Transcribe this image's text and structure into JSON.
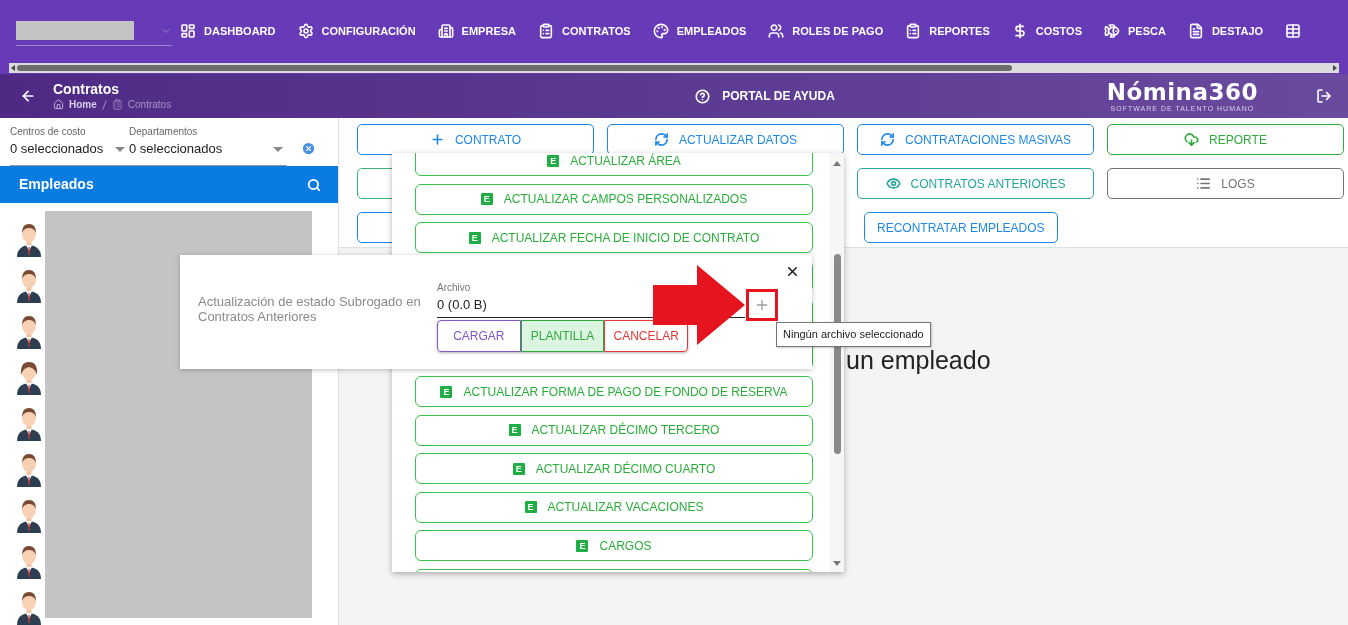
{
  "nav": {
    "items": [
      {
        "label": "DASHBOARD"
      },
      {
        "label": "CONFIGURACIÓN"
      },
      {
        "label": "EMPRESA"
      },
      {
        "label": "CONTRATOS"
      },
      {
        "label": "EMPLEADOS"
      },
      {
        "label": "ROLES DE PAGO"
      },
      {
        "label": "REPORTES"
      },
      {
        "label": "COSTOS"
      },
      {
        "label": "PESCA"
      },
      {
        "label": "DESTAJO"
      }
    ]
  },
  "header": {
    "title": "Contratos",
    "breadcrumb": [
      {
        "label": "Home",
        "selected": false
      },
      {
        "label": "Contratos",
        "selected": true
      }
    ],
    "help": "PORTAL DE AYUDA",
    "logo": {
      "name": "Nómina360",
      "tagline": "SOFTWARE DE TALENTO HUMANO"
    }
  },
  "filters": [
    {
      "label": "Centros de costo",
      "value": "0 seleccionados"
    },
    {
      "label": "Departamentos",
      "value": "0 seleccionados"
    }
  ],
  "employees_panel": {
    "title": "Empleados",
    "employees": [
      {
        "kind": "male"
      },
      {
        "kind": "male"
      },
      {
        "kind": "male"
      },
      {
        "kind": "female"
      },
      {
        "kind": "male"
      },
      {
        "kind": "male"
      },
      {
        "kind": "male"
      },
      {
        "kind": "male"
      },
      {
        "kind": "male"
      }
    ]
  },
  "actions": [
    [
      {
        "kind": "full",
        "label": "CONTRATO",
        "color": "#1e88e5"
      },
      {
        "kind": "full",
        "label": "ACTUALIZAR DATOS",
        "color": "#1e88e5"
      },
      {
        "kind": "full",
        "label": "CONTRATACIONES MASIVAS",
        "color": "#1e88e5"
      },
      {
        "kind": "full",
        "label": "REPORTE",
        "color": "#2eaa3c"
      }
    ],
    [
      {
        "kind": "covered",
        "color": "#3bb17a"
      },
      {
        "kind": "hidden"
      },
      {
        "kind": "full",
        "label": "CONTRATOS ANTERIORES",
        "color": "#26a69a"
      },
      {
        "kind": "full",
        "label": "LOGS",
        "color": "#757575"
      }
    ],
    [
      {
        "kind": "covered",
        "color": "#1e88e5"
      },
      {
        "kind": "hidden"
      },
      {
        "kind": "compact",
        "label": "RECONTRATAR EMPLEADOS",
        "color": "#1e88e5"
      }
    ]
  ],
  "menu": {
    "items": [
      {
        "kind": "action",
        "label": "ACTUALIZAR ÁREA",
        "badge": "E"
      },
      {
        "kind": "action",
        "label": "ACTUALIZAR CAMPOS PERSONALIZADOS",
        "badge": "E"
      },
      {
        "kind": "action",
        "label": "ACTUALIZAR FECHA DE INICIO DE CONTRATO",
        "badge": "E"
      },
      {
        "kind": "covered"
      },
      {
        "kind": "covered"
      },
      {
        "kind": "covered"
      },
      {
        "kind": "action",
        "label": "ACTUALIZAR FORMA DE PAGO DE FONDO DE RESERVA",
        "badge": "E"
      },
      {
        "kind": "action",
        "label": "ACTUALIZAR DÉCIMO TERCERO",
        "badge": "E"
      },
      {
        "kind": "action",
        "label": "ACTUALIZAR DÉCIMO CUARTO",
        "badge": "E"
      },
      {
        "kind": "action",
        "label": "ACTUALIZAR VACACIONES",
        "badge": "E"
      },
      {
        "kind": "action",
        "label": "CARGOS",
        "badge": "E"
      },
      {
        "kind": "cut"
      }
    ]
  },
  "dialog": {
    "description": "Actualización de estado Subrogado en Contratos Anteriores",
    "field": {
      "label": "Archivo",
      "value": "0 (0.0 B)"
    },
    "buttons": [
      {
        "label": "CARGAR",
        "color": "#7e57c2",
        "filled": false
      },
      {
        "label": "PLANTILLA",
        "color": "#2eaa3c",
        "filled": true
      },
      {
        "label": "CANCELAR",
        "color": "#e53935",
        "filled": false
      }
    ],
    "tooltip": "Ningún archivo seleccionado"
  },
  "background_text": "un empleado"
}
